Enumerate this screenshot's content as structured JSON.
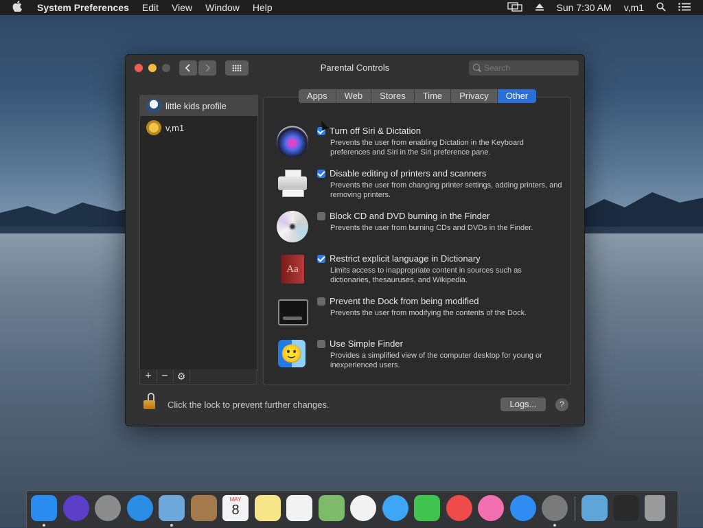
{
  "menubar": {
    "app": "System Preferences",
    "items": [
      "Edit",
      "View",
      "Window",
      "Help"
    ],
    "clock": "Sun 7:30 AM",
    "user": "v,m1"
  },
  "window": {
    "title": "Parental Controls",
    "search_placeholder": "Search"
  },
  "users": [
    {
      "name": "little kids profile",
      "selected": true
    },
    {
      "name": "v,m1",
      "selected": false
    }
  ],
  "userbar": {
    "add": "+",
    "remove": "−",
    "gear": "⚙"
  },
  "tabs": [
    {
      "label": "Apps",
      "active": false
    },
    {
      "label": "Web",
      "active": false
    },
    {
      "label": "Stores",
      "active": false
    },
    {
      "label": "Time",
      "active": false
    },
    {
      "label": "Privacy",
      "active": false
    },
    {
      "label": "Other",
      "active": true
    }
  ],
  "options": [
    {
      "title": "Turn off Siri & Dictation",
      "desc": "Prevents the user from enabling Dictation in the Keyboard preferences and Siri in the Siri preference pane.",
      "checked": true,
      "icon": "siri-icon"
    },
    {
      "title": "Disable editing of printers and scanners",
      "desc": "Prevents the user from changing printer settings, adding printers, and removing printers.",
      "checked": true,
      "icon": "printer-icon"
    },
    {
      "title": "Block CD and DVD burning in the Finder",
      "desc": "Prevents the user from burning CDs and DVDs in the Finder.",
      "checked": false,
      "icon": "cd-icon"
    },
    {
      "title": "Restrict explicit language in Dictionary",
      "desc": "Limits access to inappropriate content in sources such as dictionaries, thesauruses, and Wikipedia.",
      "checked": true,
      "icon": "dictionary-icon"
    },
    {
      "title": "Prevent the Dock from being modified",
      "desc": "Prevents the user from modifying the contents of the Dock.",
      "checked": false,
      "icon": "dock-icon"
    },
    {
      "title": "Use Simple Finder",
      "desc": "Provides a simplified view of the computer desktop for young or inexperienced users.",
      "checked": false,
      "icon": "finder-icon"
    }
  ],
  "dictionary_icon_text": "Aa",
  "footer": {
    "lock_text": "Click the lock to prevent further changes.",
    "logs_label": "Logs...",
    "help_label": "?"
  },
  "dock": {
    "apps": [
      {
        "name": "finder-icon",
        "color": "#2a8cf0",
        "running": true
      },
      {
        "name": "siri-icon",
        "color": "#5b3fc9",
        "running": false
      },
      {
        "name": "launchpad-icon",
        "color": "#8c8c8c",
        "running": false
      },
      {
        "name": "safari-icon",
        "color": "#2a8ee6",
        "running": false
      },
      {
        "name": "mail-icon",
        "color": "#6fa9dc",
        "running": true
      },
      {
        "name": "contacts-icon",
        "color": "#a57a4a",
        "running": false
      },
      {
        "name": "calendar-icon",
        "color": "#f4f4f4",
        "running": false
      },
      {
        "name": "notes-icon",
        "color": "#f7e58a",
        "running": false
      },
      {
        "name": "reminders-icon",
        "color": "#f2f2f2",
        "running": false
      },
      {
        "name": "maps-icon",
        "color": "#7dbb6a",
        "running": false
      },
      {
        "name": "photos-icon",
        "color": "#f3f3f3",
        "running": false
      },
      {
        "name": "messages-icon",
        "color": "#3da7f5",
        "running": false
      },
      {
        "name": "facetime-icon",
        "color": "#3fc44f",
        "running": false
      },
      {
        "name": "news-icon",
        "color": "#f04b4b",
        "running": false
      },
      {
        "name": "itunes-icon",
        "color": "#f46fb0",
        "running": false
      },
      {
        "name": "app-store-icon",
        "color": "#2e8cf2",
        "running": false
      },
      {
        "name": "system-preferences-icon",
        "color": "#7a7a7a",
        "running": true
      }
    ],
    "right": [
      {
        "name": "downloads-folder-icon",
        "color": "#5fa6d8"
      },
      {
        "name": "screenshot-stack-icon",
        "color": "#2a2a2a"
      },
      {
        "name": "trash-icon",
        "color": "#9a9a9a"
      }
    ],
    "calendar": {
      "month": "MAY",
      "day": "8"
    }
  }
}
